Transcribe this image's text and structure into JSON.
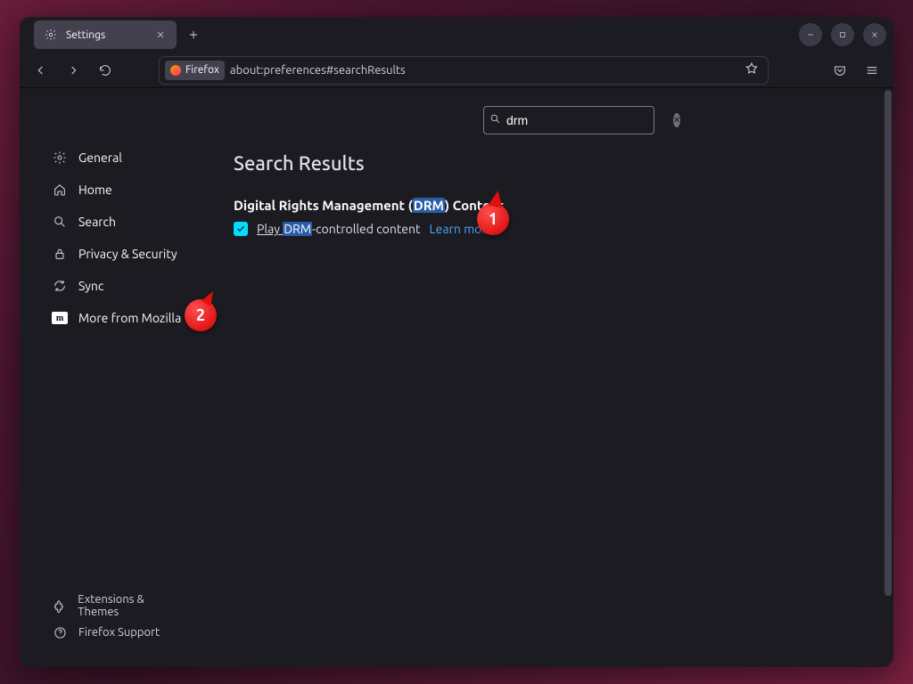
{
  "tab": {
    "title": "Settings"
  },
  "url": {
    "badge": "Firefox",
    "text": "about:preferences#searchResults"
  },
  "sidebar": {
    "items": [
      {
        "label": "General"
      },
      {
        "label": "Home"
      },
      {
        "label": "Search"
      },
      {
        "label": "Privacy & Security"
      },
      {
        "label": "Sync"
      },
      {
        "label": "More from Mozilla"
      }
    ],
    "bottom": [
      {
        "label": "Extensions & Themes"
      },
      {
        "label": "Firefox Support"
      }
    ]
  },
  "search": {
    "value": "drm"
  },
  "main": {
    "heading": "Search Results",
    "section_prefix": "Digital Rights Management (",
    "section_hl": "DRM",
    "section_suffix": ") Content",
    "checkbox_prefix": "Play ",
    "checkbox_hl": "DRM",
    "checkbox_suffix": "-controlled content",
    "learn_more": "Learn more"
  },
  "callouts": {
    "c1": "1",
    "c2": "2"
  }
}
